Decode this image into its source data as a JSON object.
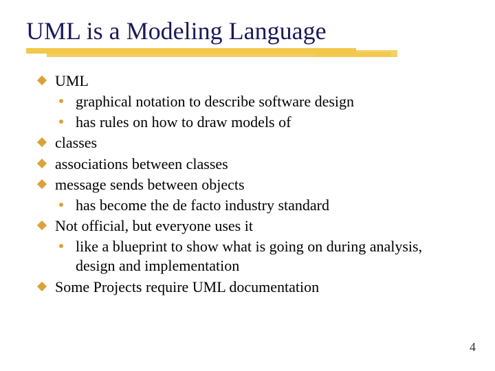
{
  "title": "UML is a Modeling Language",
  "page_number": "4",
  "bullets": [
    {
      "level": 1,
      "text": "UML"
    },
    {
      "level": 2,
      "text": "graphical notation to describe software design"
    },
    {
      "level": 2,
      "text": "has rules on how to draw models of"
    },
    {
      "level": 1,
      "text": "classes"
    },
    {
      "level": 1,
      "text": "associations between classes"
    },
    {
      "level": 1,
      "text": "message sends between objects"
    },
    {
      "level": 2,
      "text": "has become the de facto industry standard"
    },
    {
      "level": 1,
      "text": "Not official, but everyone uses it"
    },
    {
      "level": 2,
      "text": "like a blueprint to show what is going on during analysis, design and implementation"
    },
    {
      "level": 1,
      "text": "Some Projects require UML documentation"
    }
  ]
}
